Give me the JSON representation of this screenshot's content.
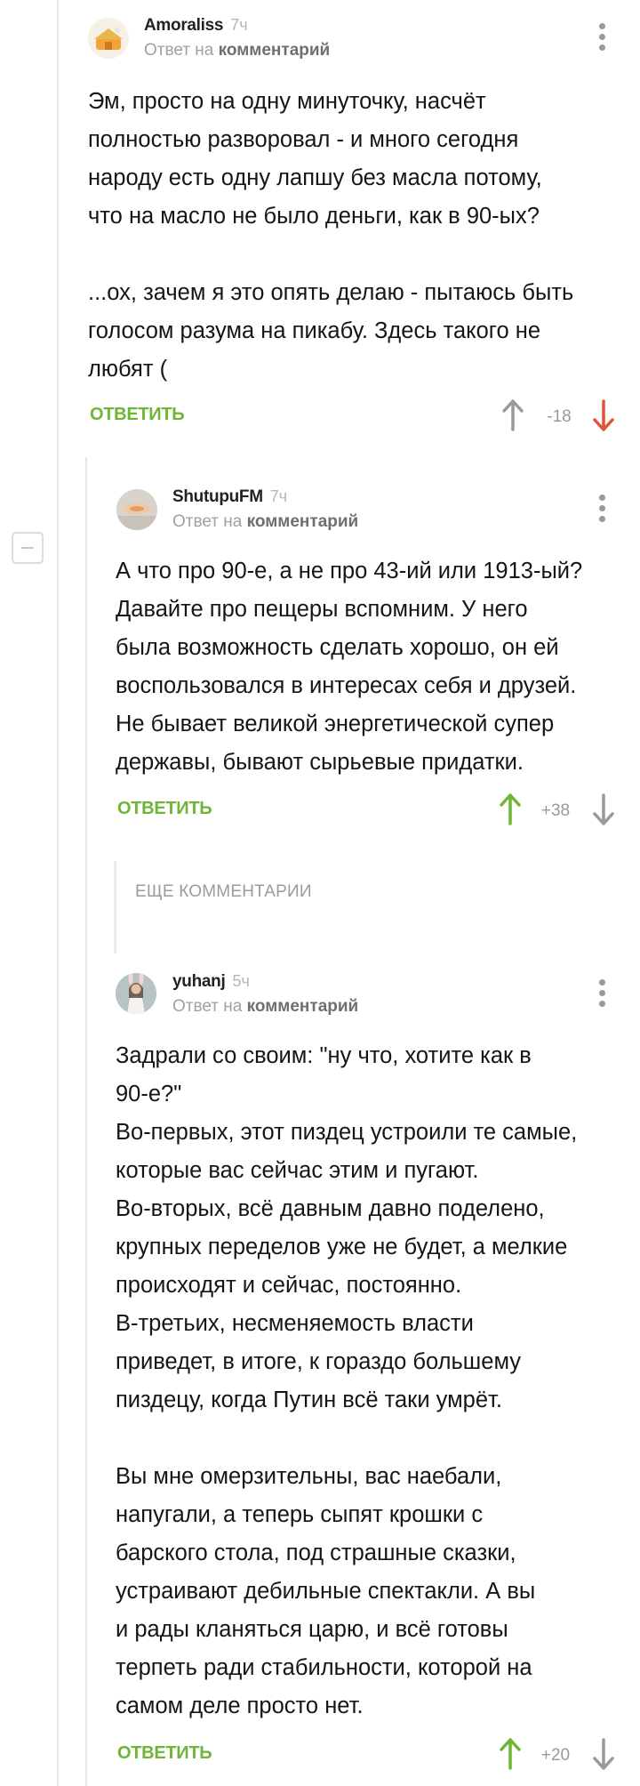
{
  "comments": [
    {
      "author": "Amoraliss",
      "time": "7ч",
      "reply_prefix": "Ответ на",
      "reply_link": "комментарий",
      "text": "Эм, просто на одну минуточку, насчёт\nполностью разворовал - и много сегодня\nнароду есть одну лапшу без масла потому,\nчто на масло не было деньги, как в 90-ых?\n\n...ох, зачем я это опять делаю - пытаюсь быть\nголосом разума на пикабу. Здесь такого не\nлюбят (",
      "reply_label": "ОТВЕТИТЬ",
      "score": "-18",
      "vote_state": "down"
    },
    {
      "author": "ShutupuFM",
      "time": "7ч",
      "reply_prefix": "Ответ на",
      "reply_link": "комментарий",
      "text": "А что про 90-е, а не про 43-ий или 1913-ый?\nДавайте про пещеры вспомним. У него\nбыла возможность сделать хорошо, он ей\nвоспользовался в интересах себя и друзей.\nНе бывает великой энергетической супер\nдержавы, бывают сырьевые придатки.",
      "reply_label": "ОТВЕТИТЬ",
      "score": "+38",
      "vote_state": "up"
    },
    {
      "author": "yuhanj",
      "time": "5ч",
      "reply_prefix": "Ответ на",
      "reply_link": "комментарий",
      "text": "Задрали со своим: \"ну что, хотите как в\n90-е?\"\nВо-первых, этот пиздец устроили те самые,\nкоторые вас сейчас этим и пугают.\nВо-вторых, всё давным давно поделено,\nкрупных переделов уже не будет, а мелкие\nпроисходят и сейчас, постоянно.\nВ-третьих, несменяемость власти\nприведет, в итоге, к гораздо большему\nпиздецу, когда Путин всё таки умрёт.\n\nВы мне омерзительны, вас наебали,\nнапугали, а теперь сыпят крошки с\nбарского стола, под страшные сказки,\nустраивают дебильные спектакли. А вы\nи рады кланяться царю, и всё готовы\nтерпеть ради стабильности, которой на\nсамом деле просто нет.",
      "reply_label": "ОТВЕТИТЬ",
      "score": "+20",
      "vote_state": "up"
    }
  ],
  "more_comments_label": "ЕЩЕ КОММЕНТАРИИ",
  "colors": {
    "accent_green": "#6fb536",
    "down_red": "#e2543a",
    "muted_gray": "#9a9a9a"
  },
  "icons": [
    "vote-up-icon",
    "vote-down-icon",
    "more-dots-icon",
    "collapse-minus-icon"
  ]
}
